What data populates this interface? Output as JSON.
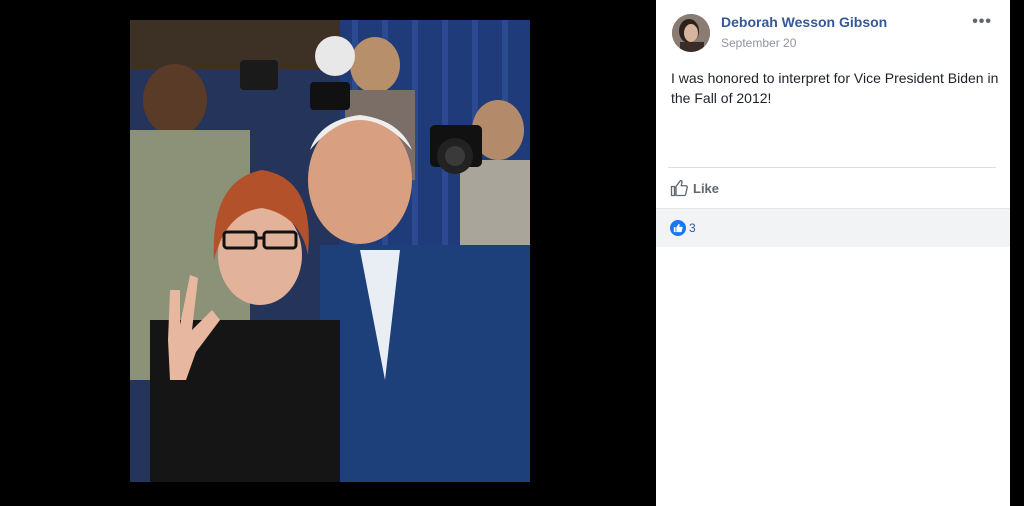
{
  "post": {
    "author_name": "Deborah Wesson Gibson",
    "date": "September 20",
    "message": "I was honored to interpret for Vice President Biden in the Fall of 2012!",
    "actions": {
      "like_label": "Like"
    },
    "reactions": {
      "count": "3",
      "type_icon": "thumbs-up-icon"
    }
  },
  "icons": {
    "more": "more-options-icon",
    "like": "thumbs-up-icon"
  },
  "colors": {
    "author_link": "#365899",
    "reaction_blue": "#1877f2",
    "text_secondary": "#606770"
  }
}
